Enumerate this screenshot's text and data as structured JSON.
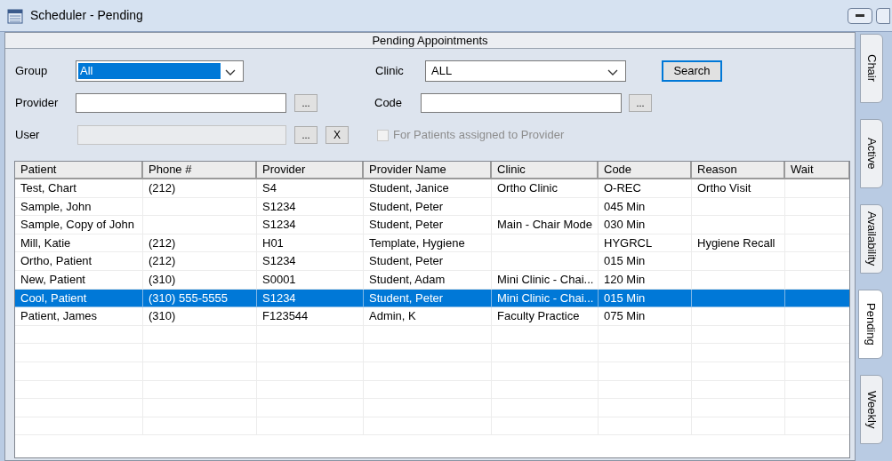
{
  "window": {
    "title": "Scheduler - Pending"
  },
  "panel": {
    "title": "Pending Appointments"
  },
  "filters": {
    "group": {
      "label": "Group",
      "value": "All"
    },
    "clinic": {
      "label": "Clinic",
      "value": "ALL"
    },
    "search_button": "Search",
    "provider": {
      "label": "Provider",
      "browse": "..."
    },
    "code": {
      "label": "Code",
      "browse": "..."
    },
    "user": {
      "label": "User",
      "browse": "...",
      "clear": "X",
      "disabled": true
    },
    "assigned": {
      "label": "For Patients assigned to Provider",
      "checked": false,
      "disabled": true
    }
  },
  "table": {
    "columns": [
      "Patient",
      "Phone #",
      "Provider",
      "Provider Name",
      "Clinic",
      "Code",
      "Reason",
      "Wait"
    ],
    "rows": [
      {
        "cells": [
          "Test, Chart",
          "(212)",
          "S4",
          "Student, Janice",
          "Ortho Clinic",
          "O-REC",
          "Ortho Visit",
          ""
        ],
        "selected": false
      },
      {
        "cells": [
          "Sample, John",
          "",
          "S1234",
          "Student, Peter",
          "",
          "045 Min",
          "",
          ""
        ],
        "selected": false
      },
      {
        "cells": [
          "Sample, Copy of John",
          "",
          "S1234",
          "Student, Peter",
          "Main - Chair Mode",
          "030 Min",
          "",
          ""
        ],
        "selected": false
      },
      {
        "cells": [
          "Mill, Katie",
          "(212)",
          "H01",
          "Template, Hygiene",
          "",
          "HYGRCL",
          "Hygiene Recall",
          ""
        ],
        "selected": false
      },
      {
        "cells": [
          "Ortho, Patient",
          "(212)",
          "S1234",
          "Student, Peter",
          "",
          "015 Min",
          "",
          ""
        ],
        "selected": false
      },
      {
        "cells": [
          "New, Patient",
          "(310)",
          "S0001",
          "Student, Adam",
          "Mini Clinic - Chai...",
          "120 Min",
          "",
          ""
        ],
        "selected": false
      },
      {
        "cells": [
          "Cool, Patient",
          "(310) 555-5555",
          "S1234",
          "Student, Peter",
          "Mini Clinic - Chai...",
          "015 Min",
          "",
          ""
        ],
        "selected": true
      },
      {
        "cells": [
          "Patient, James",
          "(310)",
          "F123544",
          "Admin, K",
          "Faculty Practice",
          "075 Min",
          "",
          ""
        ],
        "selected": false
      }
    ]
  },
  "side_tabs": [
    {
      "label": "Chair",
      "selected": false
    },
    {
      "label": "Active",
      "selected": false
    },
    {
      "label": "Availability",
      "selected": false
    },
    {
      "label": "Pending",
      "selected": true
    },
    {
      "label": "Weekly",
      "selected": false
    }
  ]
}
